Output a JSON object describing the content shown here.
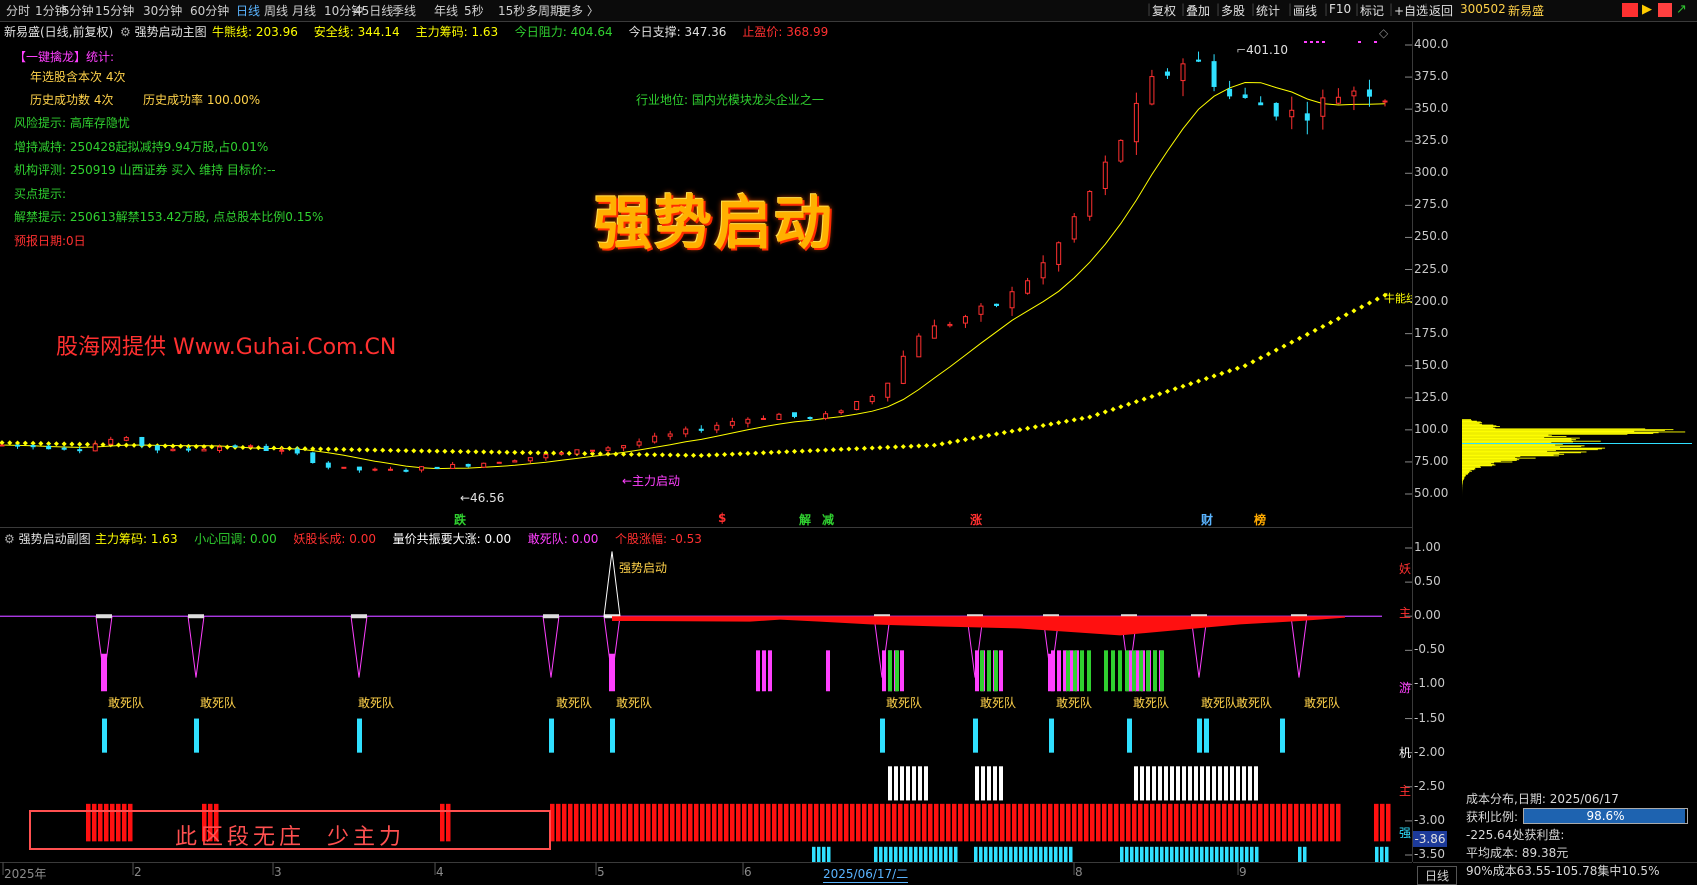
{
  "toolbar": {
    "periods": [
      "分时",
      "1分钟",
      "5分钟",
      "15分钟",
      "30分钟",
      "60分钟",
      "日线",
      "周线",
      "月线",
      "10分钟",
      "45日线",
      "季线",
      "年线",
      "5秒",
      "15秒",
      "多周期",
      "更多 〉"
    ],
    "active_period": "日线",
    "right_buttons": [
      "复权",
      "叠加",
      "多股",
      "统计",
      "画线",
      "F10",
      "标记",
      "+自选",
      "返回"
    ],
    "stock_code": "300502",
    "stock_name": "新易盛",
    "icon_colors": [
      "#ff3030",
      "#ffcc00",
      "#ff4040",
      "#30c030"
    ]
  },
  "main_header": {
    "title": "新易盛(日线,前复权)",
    "indicator": "强势启动主图",
    "items": [
      {
        "label": "牛熊线:",
        "value": "203.96",
        "color": "#ffff00"
      },
      {
        "label": "安全线:",
        "value": "344.14",
        "color": "#ffff00"
      },
      {
        "label": "主力筹码:",
        "value": "1.63",
        "color": "#ffff00"
      },
      {
        "label": "今日阻力:",
        "value": "404.64",
        "color": "#30d030"
      },
      {
        "label": "今日支撑:",
        "value": "347.36",
        "color": "#e0e0e0"
      },
      {
        "label": "止盈价:",
        "value": "368.99",
        "color": "#ff3030"
      }
    ]
  },
  "info_panel": {
    "stat_title": "【一键擒龙】统计:",
    "select_times": "年选股含本次 4次",
    "history_success": "历史成功数 4次",
    "history_rate": "历史成功率 100.00%",
    "industry": "行业地位: 国内光模块龙头企业之一",
    "risk": "风险提示: 高库存隐忧",
    "holding": "增持减持: 250428起拟减持9.94万股,占0.01%",
    "rating": "机构评测: 250919 山西证券 买入 维持 目标价:--",
    "buy_point": "买点提示:",
    "unlock": "解禁提示: 250613解禁153.42万股, 点总股本比例0.15%",
    "report_date": "预报日期:0日"
  },
  "overlay": {
    "big_title": "强势启动",
    "watermark": "股海网提供 Www.Guhai.Com.CN",
    "peak_label": "401.10",
    "low_label": "←46.56",
    "start_label": "←主力启动",
    "bull_label": "牛能线",
    "event_markers": [
      {
        "text": "跌",
        "color": "#30d030"
      },
      {
        "text": "$",
        "color": "#ff3030"
      },
      {
        "text": "解",
        "color": "#30d030"
      },
      {
        "text": "减",
        "color": "#30d030"
      },
      {
        "text": "涨",
        "color": "#ff3030"
      },
      {
        "text": "财",
        "color": "#5ab4ff"
      },
      {
        "text": "榜",
        "color": "#ffaa00"
      }
    ]
  },
  "main_axis": [
    "400.0",
    "375.0",
    "350.0",
    "325.0",
    "300.0",
    "275.0",
    "250.0",
    "225.0",
    "200.0",
    "175.0",
    "150.0",
    "125.0",
    "100.0",
    "75.00",
    "50.00"
  ],
  "sub_header": {
    "indicator": "强势启动副图",
    "items": [
      {
        "label": "主力筹码:",
        "value": "1.63",
        "color": "#ffff00"
      },
      {
        "label": "小心回调:",
        "value": "0.00",
        "color": "#30d030"
      },
      {
        "label": "妖股长成:",
        "value": "0.00",
        "color": "#ff3030"
      },
      {
        "label": "量价共振要大涨:",
        "value": "0.00",
        "color": "#ffffff"
      },
      {
        "label": "敢死队:",
        "value": "0.00",
        "color": "#ff40ff"
      },
      {
        "label": "个股涨幅:",
        "value": "-0.53",
        "color": "#ff3030"
      }
    ]
  },
  "sub_axis": [
    "1.00",
    "0.50",
    "0.00",
    "-0.50",
    "-1.00",
    "-1.50",
    "-2.00",
    "-2.50",
    "-3.00",
    "-3.50"
  ],
  "sub_current_value": "-3.86",
  "sub_right_labels": [
    {
      "text": "妖",
      "color": "#ff3030"
    },
    {
      "text": "主",
      "color": "#ff3030"
    },
    {
      "text": "游",
      "color": "#ff40ff"
    },
    {
      "text": "机",
      "color": "#ffffff"
    },
    {
      "text": "主",
      "color": "#ff3030"
    },
    {
      "text": "强",
      "color": "#30e0ff"
    }
  ],
  "sub_labels": {
    "strong_start": "强势启动",
    "dare_squad": "敢死队",
    "notice": "此区段无庄  少主力"
  },
  "x_axis": [
    "2025年",
    "2",
    "3",
    "4",
    "5",
    "6",
    "2025/06/17/二",
    "8",
    "9"
  ],
  "bottom_right_button": "日线",
  "cost_panel": {
    "title": "成本分布,日期:",
    "date": "2025/06/17",
    "profit_label": "获利比例:",
    "profit_value": "98.6%",
    "profit_fill": 0.986,
    "profit_line": "-225.64处获利盘:",
    "avg_cost": "平均成本: 89.38元",
    "range90": "90%成本63.55-105.78集中10.5%"
  },
  "colors": {
    "up": "#ff3030",
    "down": "#30e0ff",
    "ma": "#ffff00",
    "bull_line": "#ffff00",
    "magenta": "#ff40ff",
    "cyan": "#30e0ff",
    "green": "#30d030"
  }
}
